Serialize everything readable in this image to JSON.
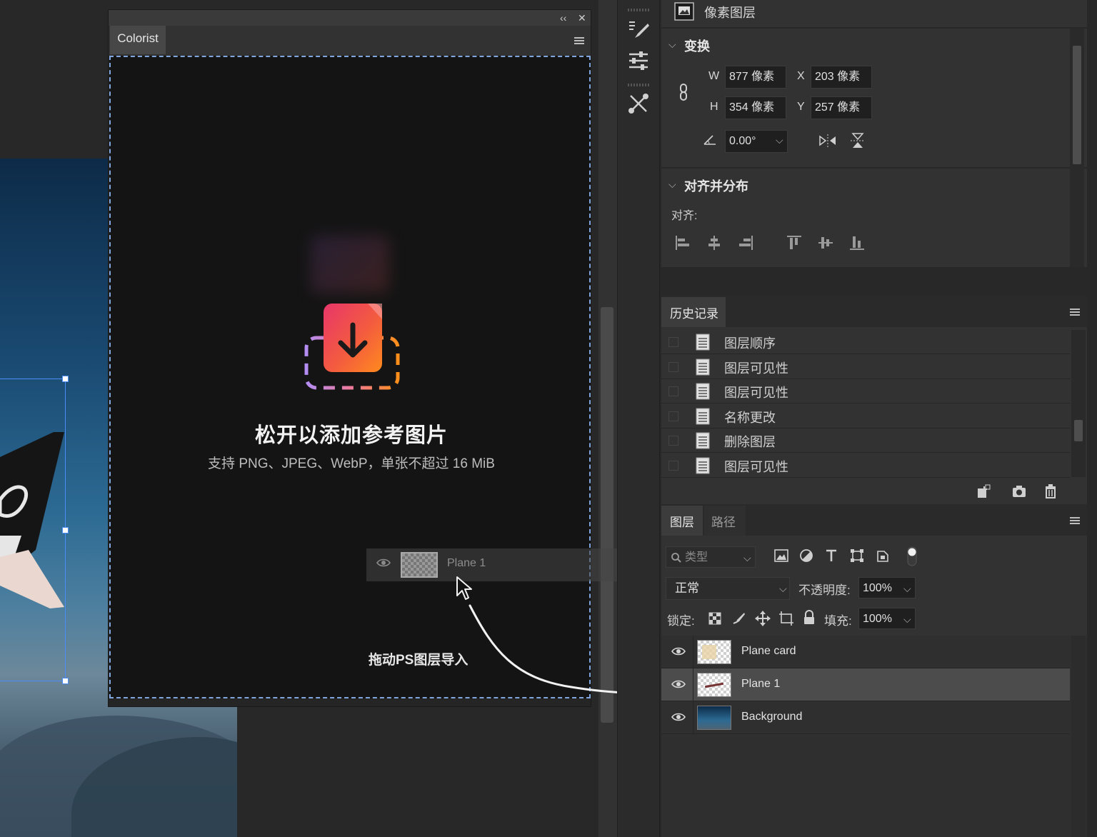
{
  "colorist": {
    "tab": "Colorist",
    "collapse_glyph": "‹‹",
    "close_glyph": "✕",
    "drop_title": "松开以添加参考图片",
    "drop_subtitle": "支持 PNG、JPEG、WebP，单张不超过 16 MiB"
  },
  "drag": {
    "layer_name": "Plane 1",
    "hint": "拖动PS图层导入"
  },
  "properties": {
    "header": "像素图层",
    "transform": {
      "section_title": "变换",
      "w_label": "W",
      "w_value": "877 像素",
      "x_label": "X",
      "x_value": "203 像素",
      "h_label": "H",
      "h_value": "354 像素",
      "y_label": "Y",
      "y_value": "257 像素",
      "angle_value": "0.00°"
    },
    "align": {
      "section_title": "对齐并分布",
      "label": "对齐:"
    }
  },
  "history": {
    "tab": "历史记录",
    "items": [
      "图层顺序",
      "图层可见性",
      "图层可见性",
      "名称更改",
      "删除图层",
      "图层可见性"
    ]
  },
  "layers": {
    "tabs": [
      "图层",
      "路径"
    ],
    "filter_placeholder": "类型",
    "blend_mode": "正常",
    "opacity_label": "不透明度:",
    "opacity_value": "100%",
    "lock_label": "锁定:",
    "fill_label": "填充:",
    "fill_value": "100%",
    "items": [
      {
        "name": "Plane card",
        "selected": false
      },
      {
        "name": "Plane 1",
        "selected": true
      },
      {
        "name": "Background",
        "selected": false
      }
    ]
  },
  "colors": {
    "selection": "#4b8df8",
    "drop_border": "#7fa5dc",
    "panel_bg": "#323232"
  }
}
